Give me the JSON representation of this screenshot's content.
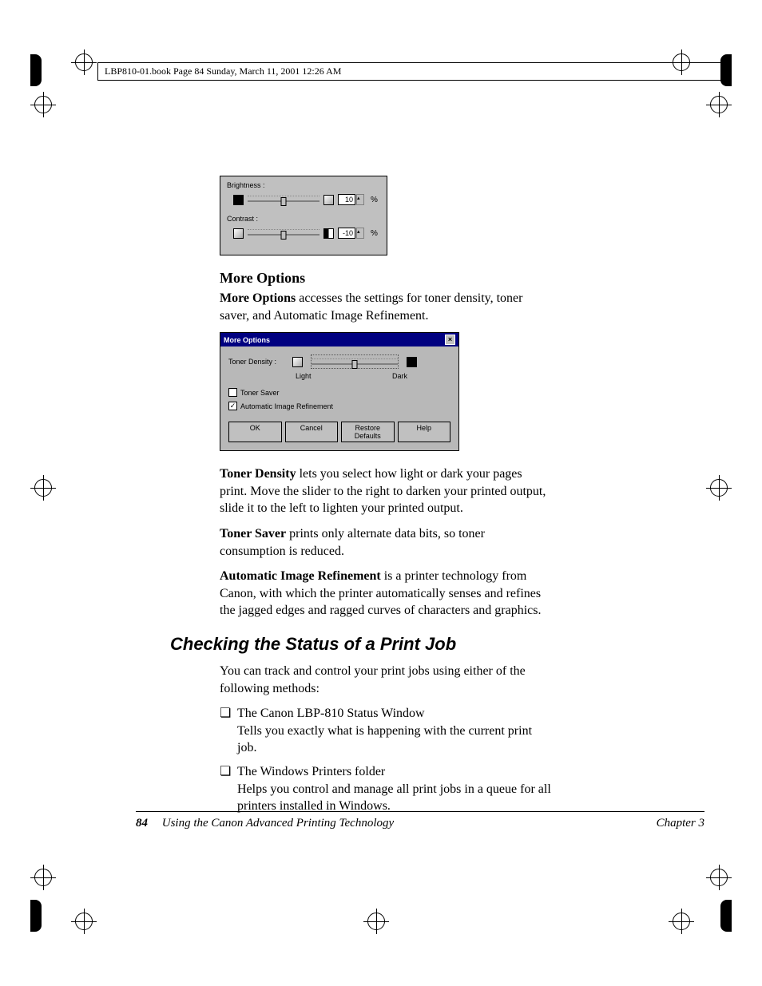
{
  "page_header": "LBP810-01.book  Page 84  Sunday, March 11, 2001  12:26 AM",
  "dialog1": {
    "brightness_label": "Brightness :",
    "contrast_label": "Contrast :",
    "brightness_value": "10",
    "contrast_value": "-10",
    "pct": "%"
  },
  "section1": {
    "heading": "More Options",
    "p1a": "More Options",
    "p1b": " accesses the settings for toner density, toner saver, and Automatic Image Refinement."
  },
  "dialog2": {
    "title": "More Options",
    "toner_density_label": "Toner Density :",
    "light": "Light",
    "dark": "Dark",
    "toner_saver": "Toner Saver",
    "air": "Automatic Image Refinement",
    "ok": "OK",
    "cancel": "Cancel",
    "restore": "Restore Defaults",
    "help": "Help"
  },
  "body": {
    "p2a": "Toner Density",
    "p2b": " lets you select how light or dark your pages print. Move the slider to the right to darken your printed output, slide it to the left to lighten your printed output.",
    "p3a": "Toner Saver",
    "p3b": " prints only alternate data bits, so toner consumption is reduced.",
    "p4a": "Automatic Image Refinement",
    "p4b": " is a printer technology from Canon, with which the printer automatically senses and refines the jagged edges and ragged curves of characters and graphics."
  },
  "section2": {
    "heading": "Checking the Status of a Print Job",
    "intro": "You can track and control your print jobs using either of the following methods:",
    "b1_title": "The Canon LBP-810 Status Window",
    "b1_desc": "Tells you exactly what is happening with the current print job.",
    "b2_title": "The Windows Printers folder",
    "b2_desc": "Helps you control and manage all print jobs in a queue for all printers installed in Windows."
  },
  "footer": {
    "page": "84",
    "title": "Using the Canon Advanced Printing Technology",
    "chapter": "Chapter 3"
  }
}
